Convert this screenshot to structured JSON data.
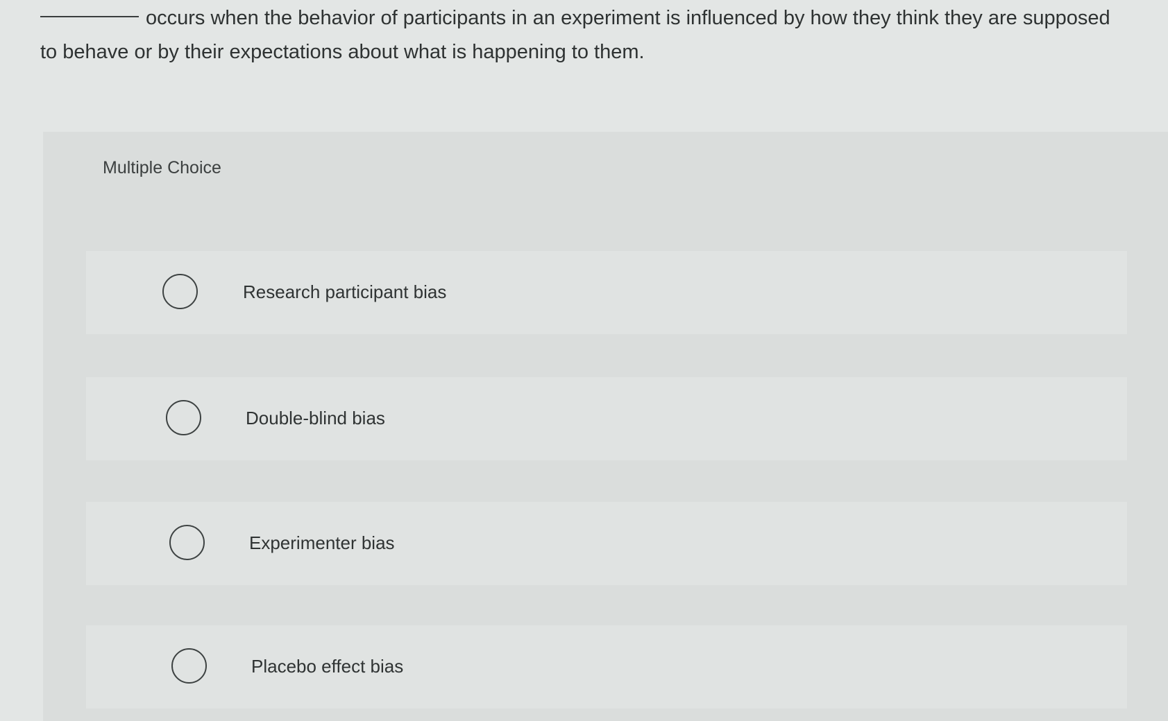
{
  "question": {
    "text": "occurs when the behavior of participants in an experiment is influenced by how they think they are supposed to behave or by their expectations about what is happening to them."
  },
  "section_label": "Multiple Choice",
  "options": [
    {
      "label": "Research participant bias"
    },
    {
      "label": "Double-blind bias"
    },
    {
      "label": "Experimenter bias"
    },
    {
      "label": "Placebo effect bias"
    }
  ],
  "colors": {
    "background": "#e3e6e5",
    "panel": "#dadddc",
    "text": "#2f3333"
  }
}
